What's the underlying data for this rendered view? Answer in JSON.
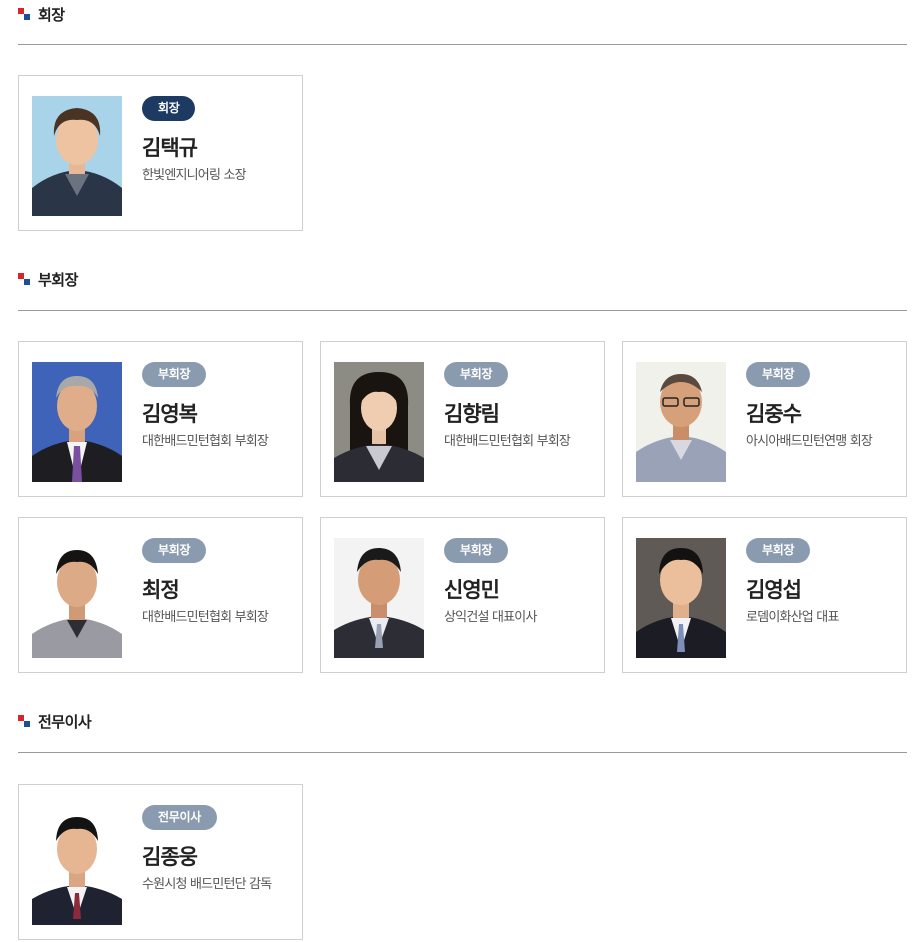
{
  "sections": {
    "president": {
      "title": "회장",
      "members": [
        {
          "badge": "회장",
          "name": "김택규",
          "desc": "한빛엔지니어링 소장"
        }
      ]
    },
    "vice": {
      "title": "부회장",
      "members": [
        {
          "badge": "부회장",
          "name": "김영복",
          "desc": "대한배드민턴협회 부회장"
        },
        {
          "badge": "부회장",
          "name": "김향림",
          "desc": "대한배드민턴협회 부회장"
        },
        {
          "badge": "부회장",
          "name": "김중수",
          "desc": "아시아배드민턴연맹 회장"
        },
        {
          "badge": "부회장",
          "name": "최정",
          "desc": "대한배드민턴협회 부회장"
        },
        {
          "badge": "부회장",
          "name": "신영민",
          "desc": "상익건설 대표이사"
        },
        {
          "badge": "부회장",
          "name": "김영섭",
          "desc": "로뎀이화산업 대표"
        }
      ]
    },
    "director": {
      "title": "전무이사",
      "members": [
        {
          "badge": "전무이사",
          "name": "김종웅",
          "desc": "수원시청 배드민턴단 감독"
        }
      ]
    }
  },
  "colors": {
    "badge_president": "#1d3a63",
    "badge_other": "#8a9bb0",
    "bullet_red": "#d8252b",
    "bullet_blue": "#1d4f97"
  }
}
